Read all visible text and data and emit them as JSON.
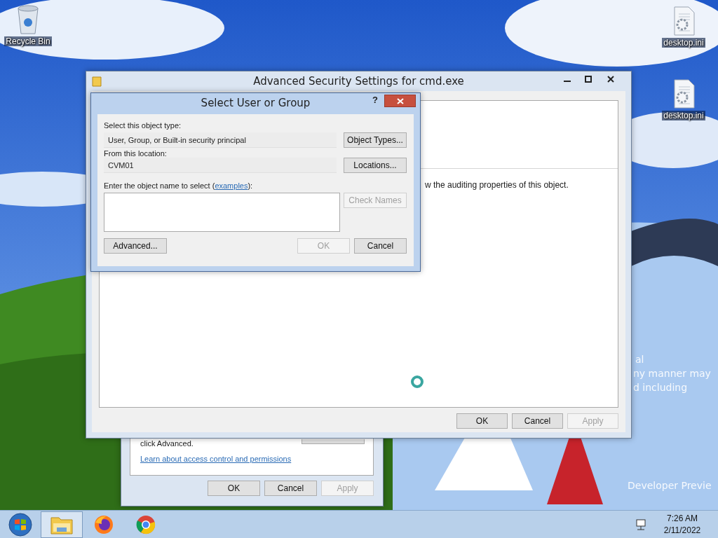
{
  "desktop": {
    "icons": [
      {
        "label": "Recycle Bin",
        "kind": "recycle"
      },
      {
        "label": "desktop.ini",
        "kind": "file"
      },
      {
        "label": "desktop.ini",
        "kind": "file"
      }
    ],
    "notice_lines": [
      "al",
      "ny manner may",
      "d including",
      "Developer Previe"
    ]
  },
  "back_window": {
    "text": "click Advanced.",
    "link": "Learn about access control and permissions",
    "buttons": [
      {
        "label": "OK",
        "disabled": false
      },
      {
        "label": "Cancel",
        "disabled": false
      },
      {
        "label": "Apply",
        "disabled": true
      }
    ]
  },
  "main_window": {
    "title": "Advanced Security Settings for cmd.exe",
    "body_text": "w the auditing properties of this object.",
    "buttons": [
      {
        "label": "OK",
        "disabled": false
      },
      {
        "label": "Cancel",
        "disabled": false
      },
      {
        "label": "Apply",
        "disabled": true
      }
    ]
  },
  "dialog": {
    "title": "Select User or Group",
    "help": "?",
    "object_type_label": "Select this object type:",
    "object_type_value": "User, Group, or Built-in security principal",
    "location_label": "From this location:",
    "location_value": "CVM01",
    "name_label_before": "Enter the object name to select (",
    "name_label_link": "examples",
    "name_label_after": "):",
    "buttons": [
      {
        "label": "Object Types...",
        "kind": "object_types",
        "disabled": false
      },
      {
        "label": "Locations...",
        "kind": "locations",
        "disabled": false
      },
      {
        "label": "Check Names",
        "kind": "check_names",
        "disabled": true
      },
      {
        "label": "Advanced...",
        "kind": "advanced",
        "disabled": false
      },
      {
        "label": "OK",
        "kind": "ok",
        "disabled": true
      },
      {
        "label": "Cancel",
        "kind": "cancel",
        "disabled": false
      }
    ]
  },
  "taskbar": {
    "apps": [
      {
        "kind": "explorer",
        "selected": true
      },
      {
        "kind": "firefox",
        "selected": false
      },
      {
        "kind": "chrome",
        "selected": false
      }
    ],
    "time": "7:26 AM",
    "date": "2/11/2022"
  }
}
